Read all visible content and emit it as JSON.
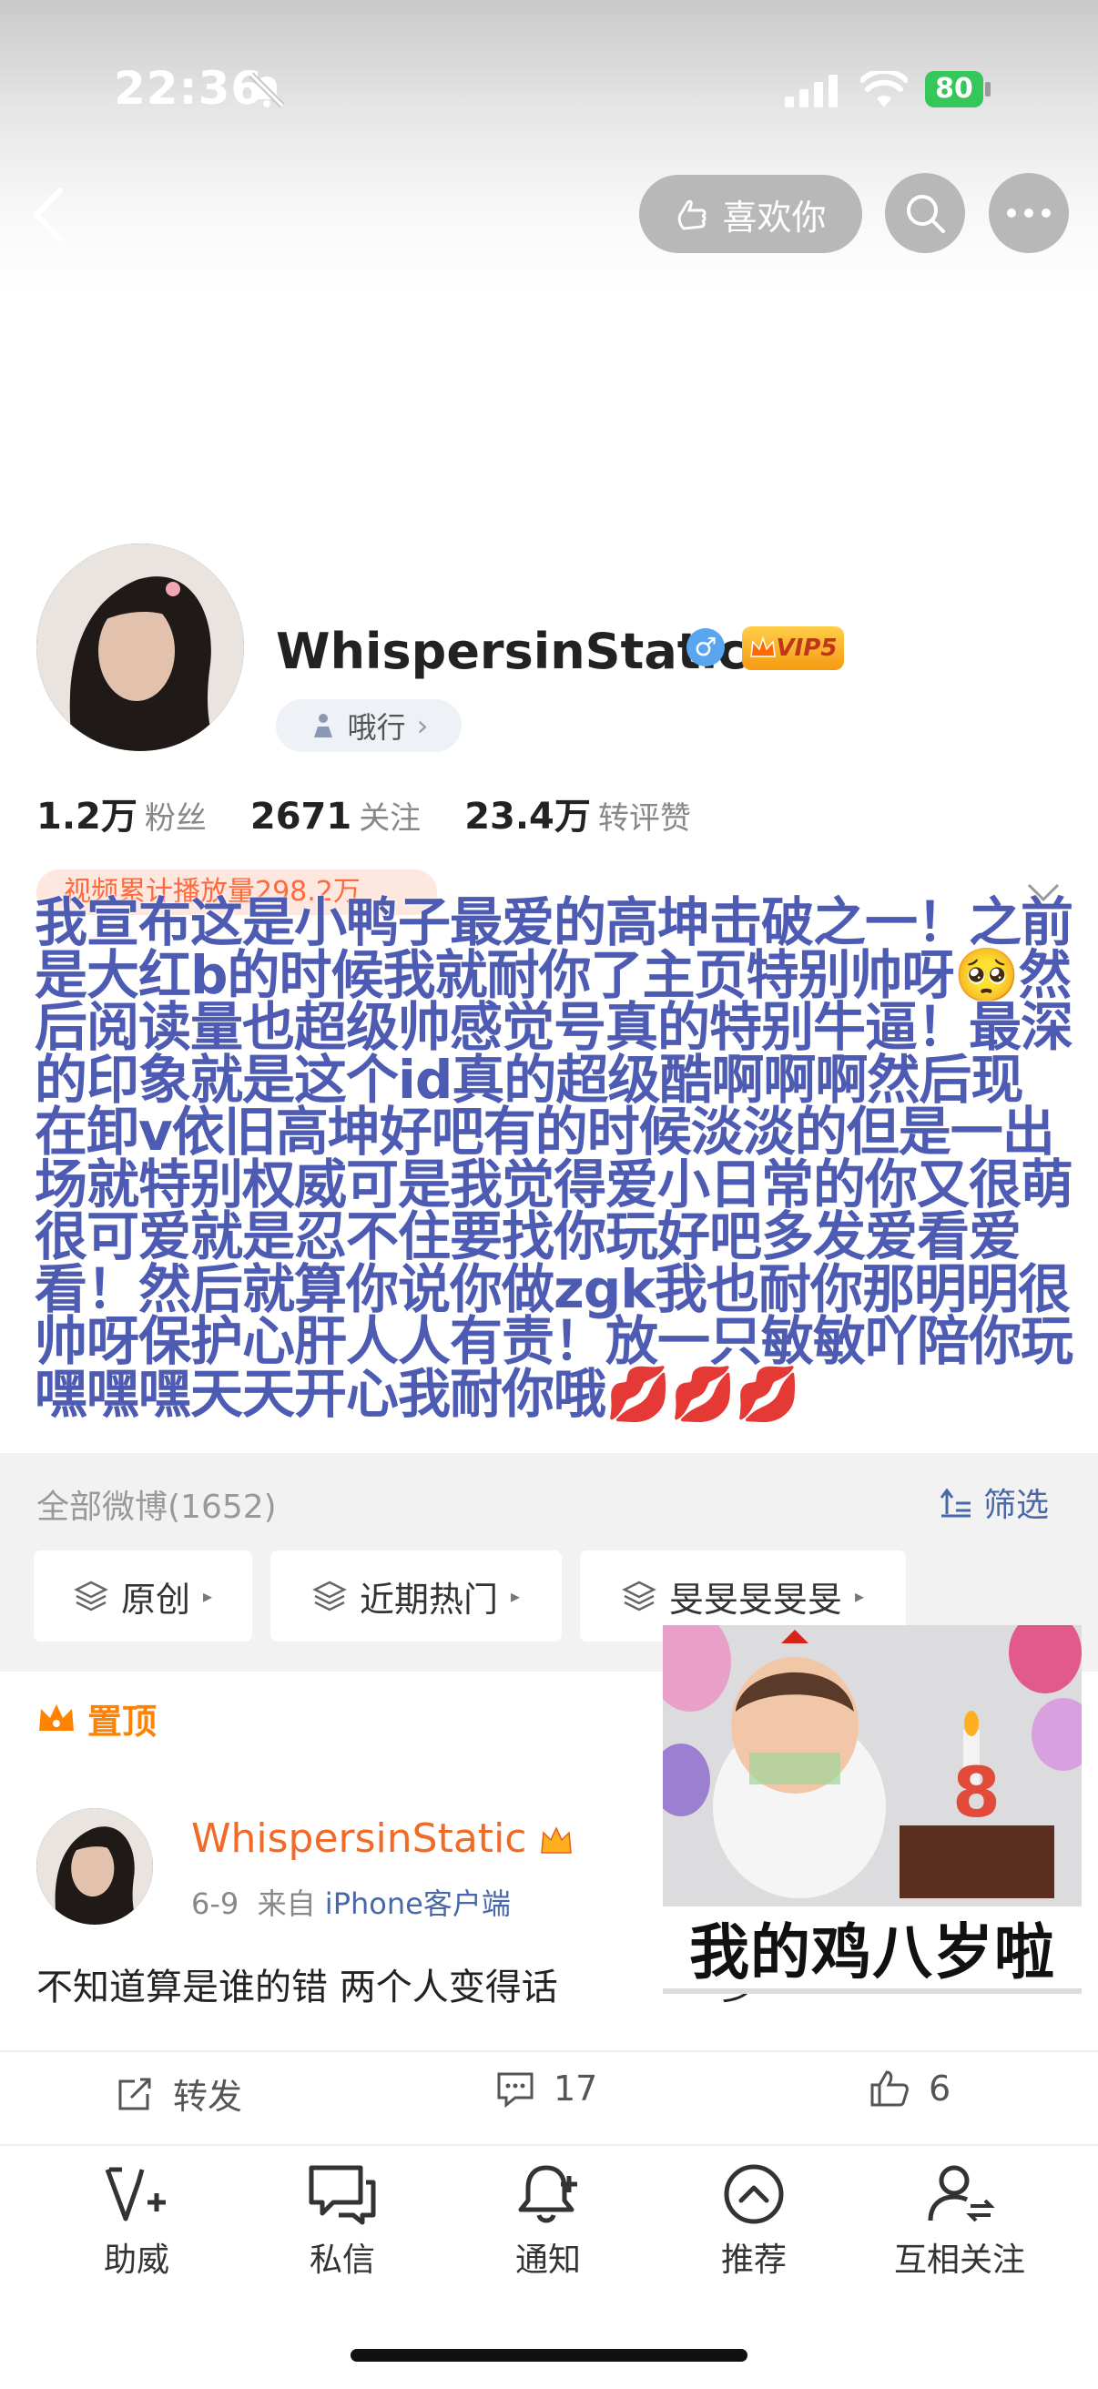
{
  "status_bar": {
    "time": "22:36",
    "battery": "80"
  },
  "header": {
    "like_label": "喜欢你"
  },
  "profile": {
    "name": "WhispersinStatic",
    "gender_symbol": "♂",
    "vip_label": "VIP5",
    "title_label": "哦行",
    "stats": [
      {
        "value": "1.2万",
        "label": "粉丝"
      },
      {
        "value": "2671",
        "label": "关注"
      },
      {
        "value": "23.4万",
        "label": "转评赞"
      }
    ],
    "play_count_badge": "视频累计播放量298.2万"
  },
  "overlay_text": "我宣布这是小鸭子最爱的高坤击破之一！之前是大红b的时候我就耐你了主页特别帅呀🥺然后阅读量也超级帅感觉号真的特别牛逼！最深的印象就是这个id真的超级酷啊啊啊然后现在卸v依旧高坤好吧有的时候淡淡的但是一出场就特别权威可是我觉得爱小日常的你又很萌很可爱就是忍不住要找你玩好吧多发爱看爱看！然后就算你说你做zgk我也耐你那明明很帅呀保护心肝人人有责！放一只敏敏吖陪你玩嘿嘿嘿天天开心我耐你哦💋💋💋",
  "feed": {
    "all_posts_label": "全部微博(1652)",
    "filter_label": "筛选",
    "chips": [
      "原创",
      "近期热门",
      "旻旻旻旻旻"
    ],
    "pinned_label": "置顶",
    "post": {
      "author": "WhispersinStatic",
      "date": "6-9",
      "from_prefix": "来自",
      "source": "iPhone客户端",
      "text": "不知道算是谁的错 两个人变得话",
      "text_tail": "少",
      "repost_label": "转发",
      "comment_count": "17",
      "like_count": "6"
    },
    "sticker_caption": "我的鸡八岁啦"
  },
  "bottom_nav": [
    "助威",
    "私信",
    "通知",
    "推荐",
    "互相关注"
  ],
  "colors": {
    "overlay_text": "#4d5bb2",
    "accent_orange": "#ff8200",
    "link_blue": "#4a68a8"
  }
}
